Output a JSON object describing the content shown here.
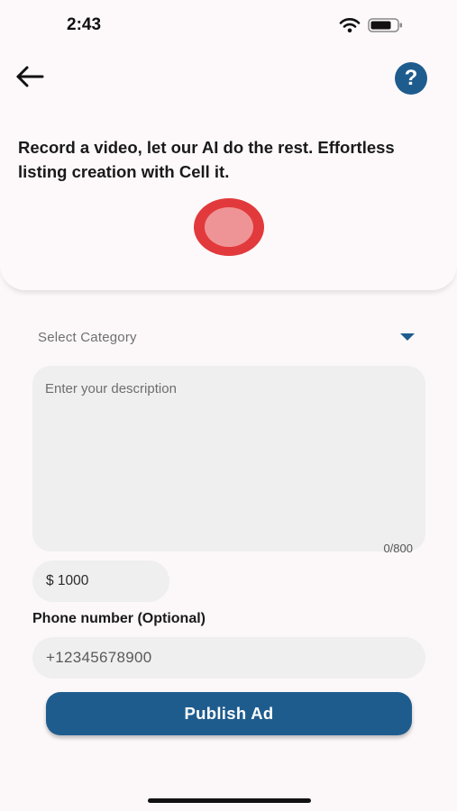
{
  "status_bar": {
    "time": "2:43",
    "icons": [
      "wifi-icon",
      "battery-icon"
    ]
  },
  "header": {
    "back_icon": "arrow-left-icon",
    "help_label": "?"
  },
  "intro": {
    "text": "Record a video, let our AI do the rest. Effortless listing creation with Cell it."
  },
  "record": {
    "icon": "record-icon",
    "color": "#e23a3c"
  },
  "form": {
    "category_placeholder": "Select Category",
    "description_placeholder": "Enter your description",
    "description_value": "",
    "description_counter": "0/800",
    "price_value": "$ 1000",
    "phone_label": "Phone number (Optional)",
    "phone_value": "+12345678900",
    "publish_label": "Publish Ad"
  },
  "colors": {
    "accent": "#1f5c8e",
    "record": "#e23a3c",
    "field_bg": "#efefef",
    "page_bg": "#fcf8f9"
  }
}
